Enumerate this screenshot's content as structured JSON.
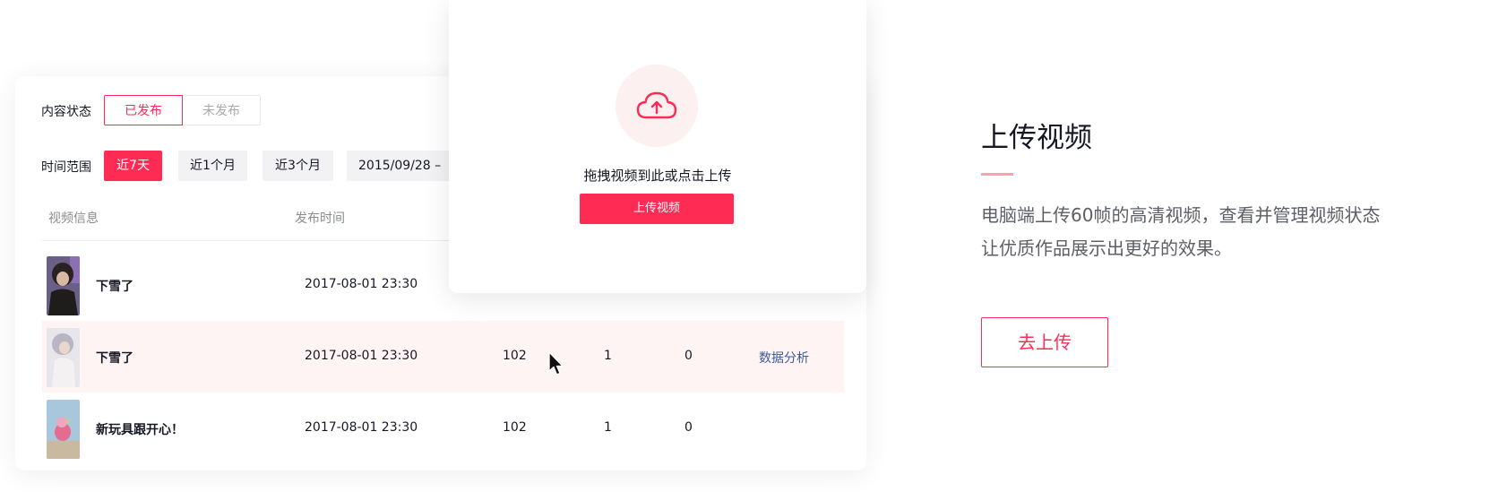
{
  "filters": {
    "status_label": "内容状态",
    "status_options": [
      "已发布",
      "未发布"
    ],
    "status_selected": "已发布",
    "time_label": "时间范围",
    "time_options": [
      "近7天",
      "近1个月",
      "近3个月"
    ],
    "time_selected": "近7天",
    "date_range_text": "2015/09/28 –"
  },
  "table": {
    "headers": {
      "video_info": "视频信息",
      "publish_time": "发布时间"
    },
    "rows": [
      {
        "title": "下雪了",
        "time": "2017-08-01 23:30",
        "col3": "",
        "col4": "",
        "col5": "",
        "action": ""
      },
      {
        "title": "下雪了",
        "time": "2017-08-01 23:30",
        "col3": "102",
        "col4": "1",
        "col5": "0",
        "action": "数据分析"
      },
      {
        "title": "新玩具跟开心！",
        "time": "2017-08-01 23:30",
        "col3": "102",
        "col4": "1",
        "col5": "0",
        "action": ""
      }
    ]
  },
  "upload_popup": {
    "icon": "cloud-upload-icon",
    "hint": "拖拽视频到此或点击上传",
    "button_label": "上传视频"
  },
  "promo": {
    "title": "上传视频",
    "desc_line1": "电脑端上传60帧的高清视频，查看并管理视频状态",
    "desc_line2": "让优质作品展示出更好的效果。",
    "button_label": "去上传"
  },
  "colors": {
    "accent": "#fe2c55",
    "highlight_row": "#fff4f4",
    "link": "#3d5a99"
  }
}
